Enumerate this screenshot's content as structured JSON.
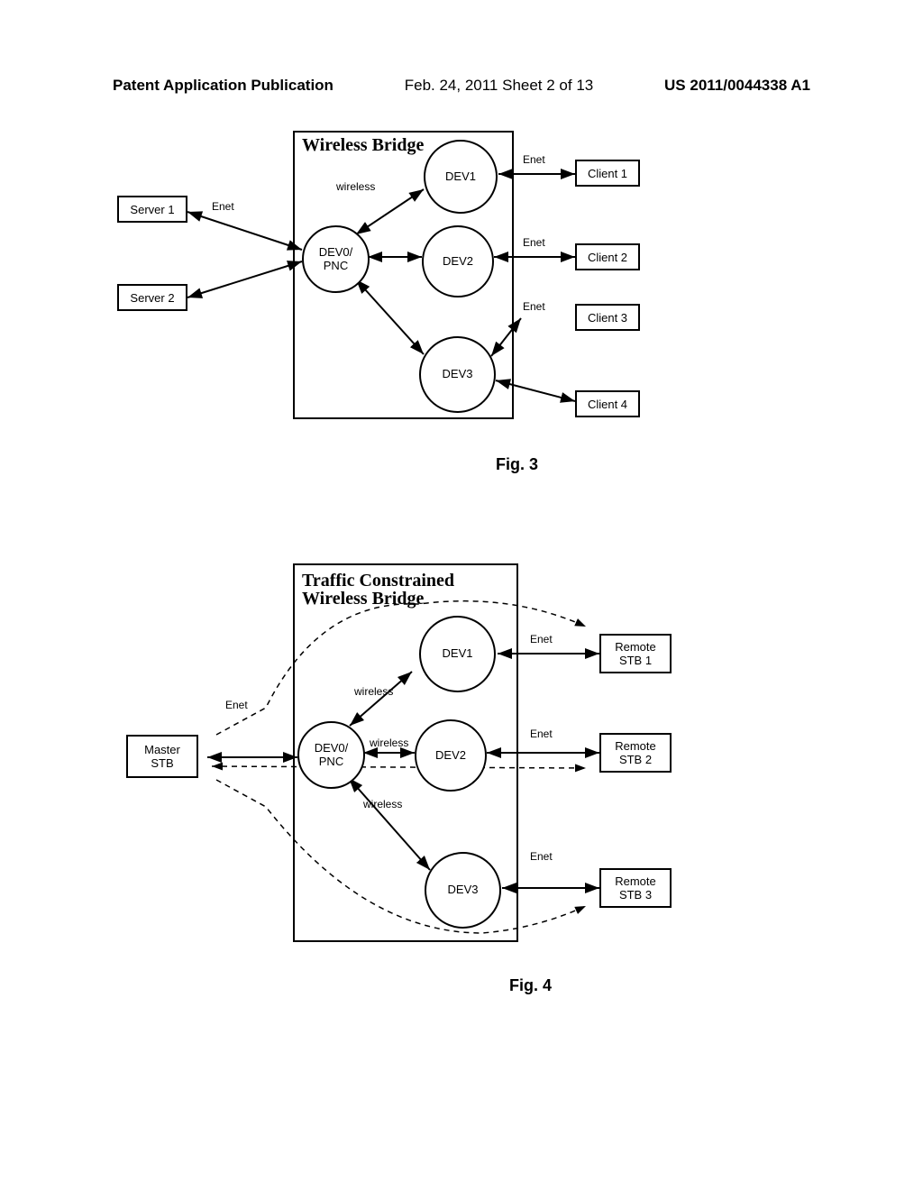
{
  "header": {
    "left": "Patent Application Publication",
    "mid": "Feb. 24, 2011  Sheet 2 of 13",
    "right": "US 2011/0044338 A1"
  },
  "fig3": {
    "title": "Wireless Bridge",
    "nodes": {
      "dev0": "DEV0/\nPNC",
      "dev1": "DEV1",
      "dev2": "DEV2",
      "dev3": "DEV3",
      "server1": "Server 1",
      "server2": "Server 2",
      "client1": "Client 1",
      "client2": "Client 2",
      "client3": "Client 3",
      "client4": "Client 4"
    },
    "labels": {
      "enet": "Enet",
      "wireless": "wireless"
    },
    "caption": "Fig. 3"
  },
  "fig4": {
    "title_line1": "Traffic Constrained",
    "title_line2": "Wireless Bridge",
    "nodes": {
      "dev0": "DEV0/\nPNC",
      "dev1": "DEV1",
      "dev2": "DEV2",
      "dev3": "DEV3",
      "master": "Master\nSTB",
      "remote1": "Remote\nSTB 1",
      "remote2": "Remote\nSTB 2",
      "remote3": "Remote\nSTB 3"
    },
    "labels": {
      "enet": "Enet",
      "wireless": "wireless"
    },
    "caption": "Fig. 4"
  }
}
